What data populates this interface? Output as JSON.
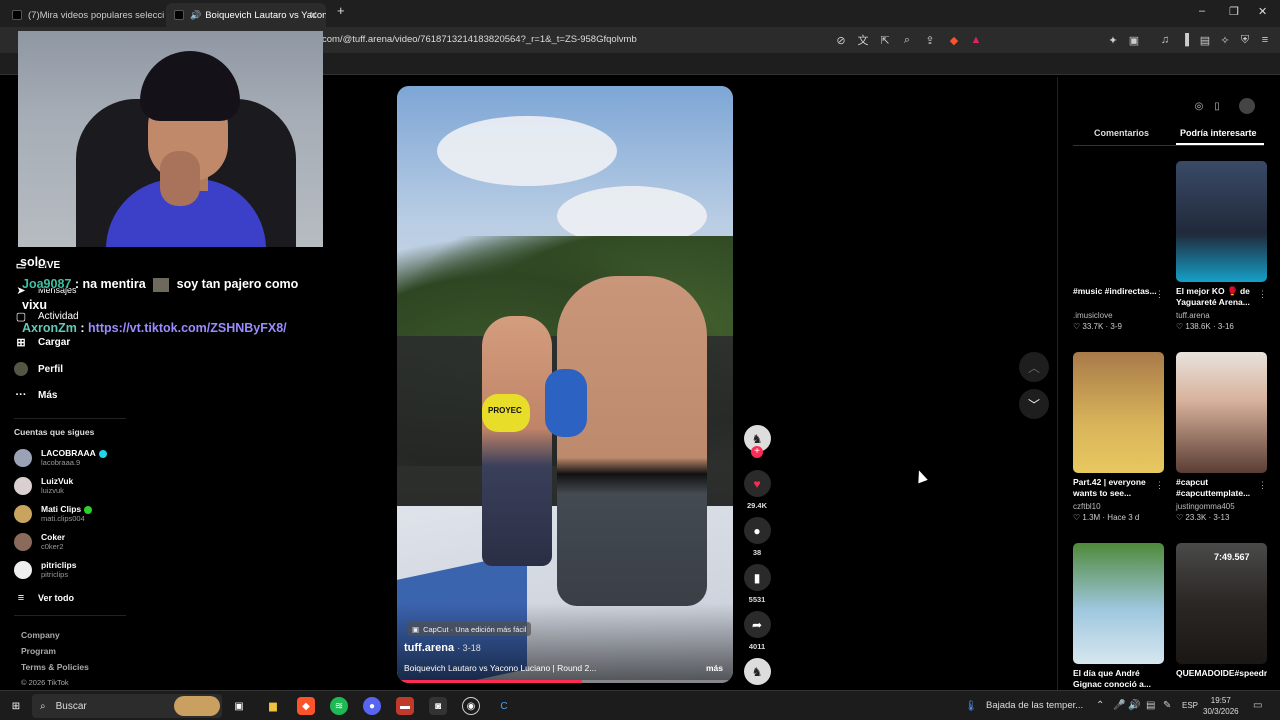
{
  "browser": {
    "tabs": [
      {
        "label": "(7)Mira videos populares seleccionad"
      },
      {
        "label": "Boiquevich Lautaro vs Yacono"
      }
    ],
    "new_tab_icon": "plus-icon",
    "url": "com/@tuff.arena/video/7618713214183820564?_r=1&_t=ZS-958Gfqolvmb",
    "window_controls": [
      "minimize-icon",
      "restore-icon",
      "close-icon"
    ]
  },
  "sidebar": {
    "nav": [
      {
        "label": "LIVE",
        "icon": "live-icon"
      },
      {
        "label": "Mensajes",
        "icon": "send-icon"
      },
      {
        "label": "Actividad",
        "icon": "inbox-icon"
      },
      {
        "label": "Cargar",
        "icon": "upload-icon"
      },
      {
        "label": "Perfil",
        "icon": "profile-icon"
      },
      {
        "label": "Más",
        "icon": "more-icon"
      }
    ],
    "following_title": "Cuentas que sigues",
    "following": [
      {
        "name": "LACOBRAAA",
        "handle": "lacobraaa.9",
        "badge": "verified",
        "color": "#9aa3b5"
      },
      {
        "name": "LuizVuk",
        "handle": "luizvuk",
        "badge": "",
        "color": "#d9d0cf"
      },
      {
        "name": "Mati Clips",
        "handle": "mati.clips004",
        "badge": "live",
        "color": "#c9a45f"
      },
      {
        "name": "Coker",
        "handle": "c0ker2",
        "badge": "",
        "color": "#8a6a5a"
      },
      {
        "name": "pitriclips",
        "handle": "pitriclips",
        "badge": "",
        "color": "#eeeeee"
      }
    ],
    "see_all": "Ver todo",
    "footer": [
      "Company",
      "Program",
      "Terms & Policies"
    ],
    "copyright": "© 2026 TikTok"
  },
  "chat": {
    "line1_user": "solo",
    "line2_user": "Joa9087",
    "line2_text": ": na mentira",
    "line2_text2": "soy tan pajero como",
    "line3_text": "vixu",
    "line4_user": "AxronZm",
    "line4_sep": ":",
    "line4_link": "https://vt.tiktok.com/ZSHNByFX8/"
  },
  "video": {
    "capcut_label": "CapCut · Una edición más fácil",
    "author": "tuff.arena",
    "date": "· 3-18",
    "title": "Boiquevich Lautaro vs Yacono Luciano | Round 2...",
    "more": "más",
    "progress": 0.55,
    "brand_text": "PROYEC"
  },
  "actions": {
    "likes": "29.4K",
    "comments": "38",
    "saves": "5531",
    "shares": "4011"
  },
  "right_panel": {
    "tabs": [
      "Comentarios",
      "Podría interesarte"
    ],
    "active_tab": 1,
    "cards": [
      {
        "title": "#music #indirectas...",
        "author": ".imusiclove",
        "meta": "♡ 33.7K · 3-9",
        "thumb": "#000000"
      },
      {
        "title": "El mejor KO 🥊 de Yaguareté Arena...",
        "author": "tuff.arena",
        "meta": "♡ 138.6K · 3-16",
        "thumb": "#2b3b52"
      },
      {
        "title": "Part.42 | everyone wants to see...",
        "author": "czftbl10",
        "meta": "♡ 1.3M · Hace 3 d",
        "thumb": "#c9a85a"
      },
      {
        "title": "#capcut #capcuttemplate...",
        "author": "justingomma405",
        "meta": "♡ 23.3K · 3-13",
        "thumb": "#d4b09a"
      },
      {
        "title": "El día que André Gignac conoció a...",
        "author": "",
        "meta": "",
        "thumb": "#4d7d3a"
      },
      {
        "title": "QUEMADOIDE#speedrunresidente...",
        "author": "",
        "meta": "",
        "thumb": "#3a3530"
      }
    ],
    "card5_overlay": "7:49.567"
  },
  "taskbar": {
    "search_placeholder": "Buscar",
    "weather": "Bajada de las temper...",
    "lang": "ESP",
    "time": "19:57",
    "date": "30/3/2026"
  }
}
